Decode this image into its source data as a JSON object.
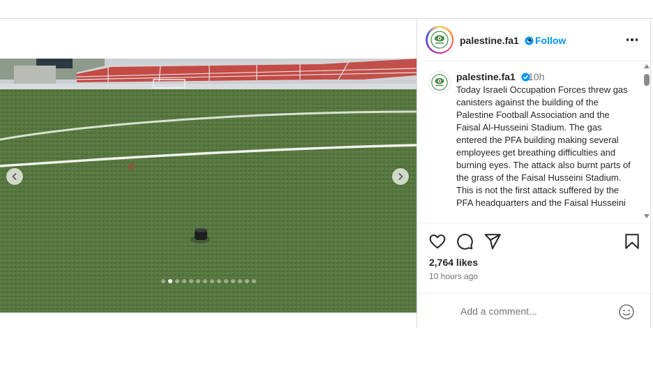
{
  "colors": {
    "accent": "#0095f6",
    "text": "#262626",
    "muted": "#737373",
    "border": "#dbdbdb"
  },
  "post": {
    "carousel": {
      "total_slides": 14,
      "active_index": 1
    },
    "prev_icon": "chevron-left-icon",
    "next_icon": "chevron-right-icon"
  },
  "header": {
    "username": "palestine.fa1",
    "separator": "•",
    "follow_label": "Follow",
    "more_icon": "more-horizontal-icon"
  },
  "caption": {
    "username": "palestine.fa1",
    "time": "10h",
    "text": "Today Israeli Occupation Forces threw gas canisters against the building of the Palestine Football Association and the Faisal Al-Husseini Stadium. The gas entered the PFA building making several employees get breathing difficulties and burning eyes. The attack also burnt parts of the grass of the Faisal Husseini Stadium. This is not the first attack suffered by the PFA headquarters and the Faisal Husseini"
  },
  "actions": {
    "like_icon": "heart-icon",
    "comment_icon": "comment-icon",
    "share_icon": "send-icon",
    "save_icon": "bookmark-icon"
  },
  "stats": {
    "likes": "2,764 likes",
    "ago": "10 hours ago"
  },
  "comment": {
    "placeholder": "Add a comment...",
    "emoji_icon": "emoji-icon"
  }
}
